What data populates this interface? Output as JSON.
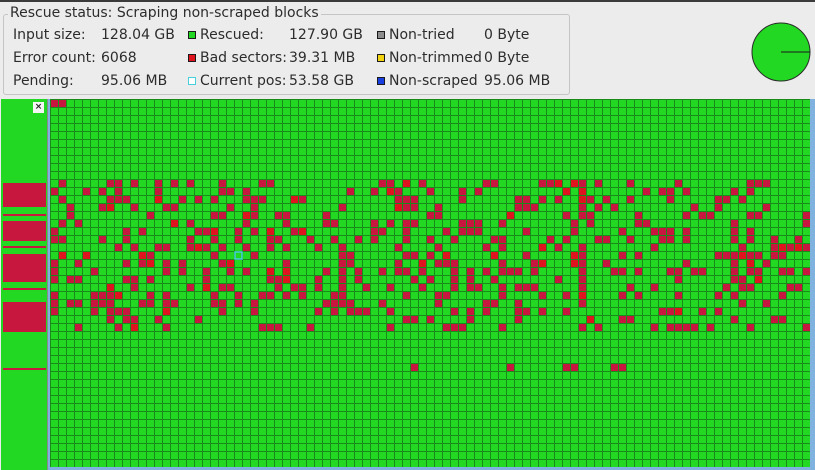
{
  "status": {
    "title": "Rescue status:  Scraping non-scraped blocks",
    "input_size_label": "Input size:",
    "input_size_value": "128.04 GB",
    "error_count_label": "Error count:",
    "error_count_value": "6068",
    "pending_label": "Pending:",
    "pending_value": "95.06 MB",
    "rescued_label": "Rescued:",
    "rescued_value": "127.90 GB",
    "bad_sectors_label": "Bad sectors:",
    "bad_sectors_value": "39.31 MB",
    "current_pos_label": "Current pos:",
    "current_pos_value": "53.58 GB",
    "non_tried_label": "Non-tried",
    "non_tried_value": "0 Byte",
    "non_trimmed_label": "Non-trimmed",
    "non_trimmed_value": "0 Byte",
    "non_scraped_label": "Non-scraped",
    "non_scraped_value": "95.06 MB"
  },
  "colors": {
    "rescued": "#22d822",
    "bad": "#c8173f",
    "bad_bright": "#e0141e",
    "non_tried": "#8c8c8c",
    "non_trimmed": "#f2d312",
    "non_scraped": "#1a3fe0",
    "current_pos": "#45d0dc",
    "grid_line": "#1a8a1a"
  },
  "progress": {
    "rescued_fraction": 0.999
  },
  "icons": {
    "close": "close-icon",
    "pie": "progress-pie"
  },
  "close_glyph": "×"
}
